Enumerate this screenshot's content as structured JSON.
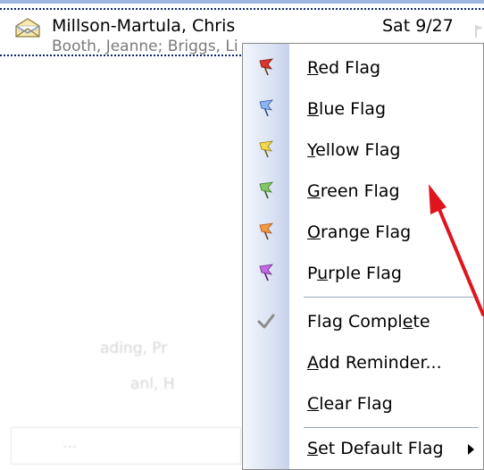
{
  "message": {
    "sender": "Millson-Martula, Chris",
    "date": "Sat 9/27",
    "recipients": "Booth, Jeanne; Briggs, Li",
    "icon": "envelope-open-icon"
  },
  "background_faint": {
    "line1": "ading, Pr",
    "line2": "anl, H",
    "line3": "..."
  },
  "context_menu": {
    "items": [
      {
        "label_pre": "",
        "mnemonic": "R",
        "label_post": "ed Flag",
        "icon": "red-flag-icon",
        "color": "#d8362a"
      },
      {
        "label_pre": "",
        "mnemonic": "B",
        "label_post": "lue Flag",
        "icon": "blue-flag-icon",
        "color": "#4f86d8"
      },
      {
        "label_pre": "",
        "mnemonic": "Y",
        "label_post": "ellow Flag",
        "icon": "yellow-flag-icon",
        "color": "#e9c51c"
      },
      {
        "label_pre": "",
        "mnemonic": "G",
        "label_post": "reen Flag",
        "icon": "green-flag-icon",
        "color": "#5eaa3c"
      },
      {
        "label_pre": "",
        "mnemonic": "O",
        "label_post": "range Flag",
        "icon": "orange-flag-icon",
        "color": "#ef8c2a"
      },
      {
        "label_pre": "P",
        "mnemonic": "u",
        "label_post": "rple Flag",
        "icon": "purple-flag-icon",
        "color": "#a54cc7"
      },
      {
        "label_pre": "Flag Compl",
        "mnemonic": "e",
        "label_post": "te",
        "icon": "checkmark-icon",
        "color": "#8c8c8c"
      },
      {
        "label_pre": "",
        "mnemonic": "A",
        "label_post": "dd Reminder...",
        "icon": "",
        "color": ""
      },
      {
        "label_pre": "",
        "mnemonic": "C",
        "label_post": "lear Flag",
        "icon": "",
        "color": ""
      },
      {
        "label_pre": "",
        "mnemonic": "S",
        "label_post": "et Default Flag",
        "icon": "",
        "color": "",
        "submenu": true
      }
    ]
  },
  "annotation": {
    "color": "#e0141c"
  }
}
